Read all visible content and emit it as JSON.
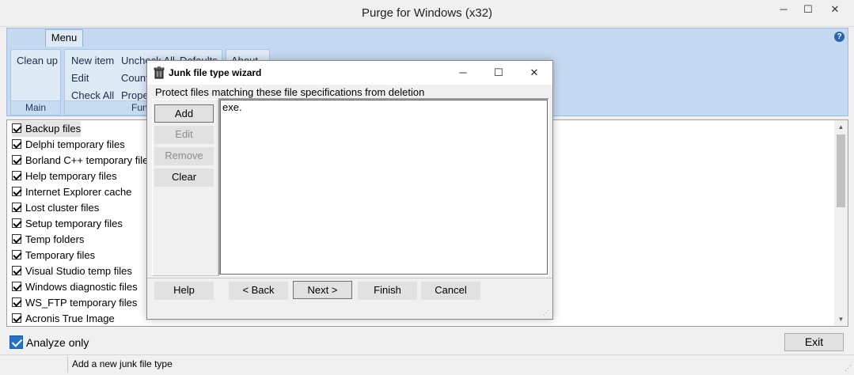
{
  "window": {
    "title": "Purge for Windows (x32)",
    "min_glyph": "─",
    "max_glyph": "☐",
    "close_glyph": "✕"
  },
  "ribbon": {
    "tab_label": "Menu",
    "help_glyph": "?",
    "groups": {
      "main": {
        "label": "Main",
        "buttons": {
          "clean_up": "Clean up"
        }
      },
      "functions": {
        "label": "Funct",
        "buttons": {
          "new_item": "New item",
          "edit": "Edit",
          "check_all": "Check All",
          "uncheck_all": "Uncheck All",
          "count": "Count",
          "properties": "Prope",
          "defaults": "Defaults"
        }
      },
      "about": {
        "label": "About"
      }
    }
  },
  "list": {
    "items": [
      {
        "label": "Backup files",
        "checked": true
      },
      {
        "label": "Delphi temporary files",
        "checked": true
      },
      {
        "label": "Borland C++ temporary file",
        "checked": true
      },
      {
        "label": "Help temporary files",
        "checked": true
      },
      {
        "label": "Internet Explorer cache",
        "checked": true
      },
      {
        "label": "Lost cluster files",
        "checked": true
      },
      {
        "label": "Setup temporary files",
        "checked": true
      },
      {
        "label": "Temp folders",
        "checked": true
      },
      {
        "label": "Temporary files",
        "checked": true
      },
      {
        "label": "Visual Studio temp files",
        "checked": true
      },
      {
        "label": "Windows diagnostic files",
        "checked": true
      },
      {
        "label": "WS_FTP temporary files",
        "checked": true
      },
      {
        "label": "Acronis True Image",
        "checked": true
      }
    ],
    "scroll_up_glyph": "▲",
    "scroll_down_glyph": "▼"
  },
  "bottom": {
    "analyze_only_label": "Analyze only",
    "analyze_only_checked": true,
    "exit_label": "Exit"
  },
  "status": {
    "text": "Add a new junk file type",
    "grip": "⋰"
  },
  "dialog": {
    "title": "Junk file type wizard",
    "min_glyph": "─",
    "max_glyph": "☐",
    "close_glyph": "✕",
    "prompt": "Protect files matching these file specifications from deletion",
    "side_buttons": {
      "add": "Add",
      "edit": "Edit",
      "remove": "Remove",
      "clear": "Clear"
    },
    "content": "exe.",
    "nav_buttons": {
      "help": "Help",
      "back": "< Back",
      "next": "Next >",
      "finish": "Finish",
      "cancel": "Cancel"
    }
  }
}
